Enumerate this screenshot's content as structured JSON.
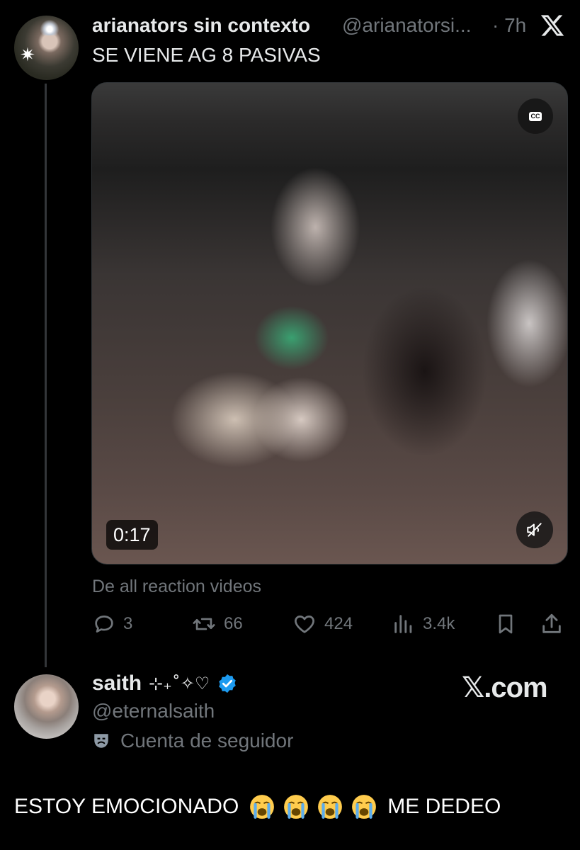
{
  "tweet": {
    "author_name": "arianators sin contexto",
    "author_handle": "@arianatorsi...",
    "time": "· 7h",
    "text": "SE VIENE AG 8 PASIVAS",
    "video": {
      "duration": "0:17",
      "cc_label": "CC"
    },
    "source_text": "De all reaction videos",
    "actions": {
      "replies": "3",
      "reposts": "66",
      "likes": "424",
      "views": "3.4k"
    }
  },
  "quote_card": {
    "author_name": "saith",
    "name_decoration": "⊹₊˚✧♡",
    "author_handle": "@eternalsaith",
    "follower_label": "Cuenta de seguidor",
    "watermark": "𝕏.com"
  },
  "caption": {
    "before": "ESTOY EMOCIONADO",
    "after": "ME DEDEO",
    "emoji_name": "loudly-crying-face",
    "emoji_count": 4
  },
  "colors": {
    "background": "#000000",
    "text": "#e7e9ea",
    "muted": "#71767b",
    "verified": "#1d9bf0",
    "thread_line": "#333639"
  }
}
